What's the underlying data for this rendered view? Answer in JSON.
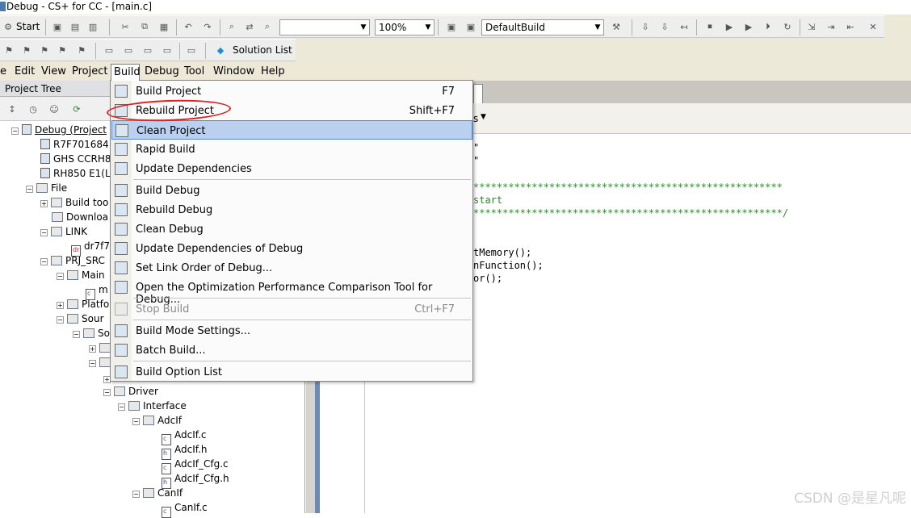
{
  "window": {
    "title": "Debug - CS+ for CC - [main.c]"
  },
  "toolbar": {
    "start_label": "Start",
    "zoom": "100%",
    "build_mode": "DefaultBuild",
    "solution_list_label": "Solution List"
  },
  "menubar": {
    "items": [
      "e",
      "Edit",
      "View",
      "Project",
      "Build",
      "Debug",
      "Tool",
      "Window",
      "Help"
    ]
  },
  "build_menu": {
    "items": [
      {
        "label": "Build Project",
        "shortcut": "F7"
      },
      {
        "label": "Rebuild Project",
        "shortcut": "Shift+F7"
      },
      {
        "label": "Clean Project",
        "shortcut": ""
      },
      {
        "label": "Rapid Build",
        "shortcut": ""
      },
      {
        "label": "Update Dependencies",
        "shortcut": ""
      },
      {
        "label": "Build Debug",
        "shortcut": ""
      },
      {
        "label": "Rebuild Debug",
        "shortcut": ""
      },
      {
        "label": "Clean Debug",
        "shortcut": ""
      },
      {
        "label": "Update Dependencies of Debug",
        "shortcut": ""
      },
      {
        "label": "Set Link Order of Debug...",
        "shortcut": ""
      },
      {
        "label": "Open the Optimization Performance Comparison Tool for Debug...",
        "shortcut": ""
      },
      {
        "label": "Stop Build",
        "shortcut": "Ctrl+F7"
      },
      {
        "label": "Build Mode Settings...",
        "shortcut": ""
      },
      {
        "label": "Batch Build...",
        "shortcut": ""
      },
      {
        "label": "Build Option List",
        "shortcut": ""
      }
    ],
    "highlighted": "Clean Project",
    "disabled": "Stop Build"
  },
  "project_tree": {
    "header": "Project Tree",
    "nodes": [
      "Debug (Project",
      "R7F701684",
      "GHS CCRH8",
      "RH850 E1(L",
      "File",
      "Build too",
      "Downloa",
      "LINK",
      "dr7f7",
      "PRJ_SRC",
      "Main",
      "m",
      "Platfo",
      "Sour",
      "So",
      "Driver",
      "Interface",
      "AdcIf",
      "AdcIf.c",
      "AdcIf.h",
      "AdcIf_Cfg.c",
      "AdcIf_Cfg.h",
      "CanIf",
      "CanIf.c"
    ]
  },
  "editor": {
    "toolbar_text": "s",
    "lines": [
      "\"",
      "\"",
      "*****************************************************",
      "start",
      "*****************************************************/",
      "tMemory();",
      "nFunction();",
      "or();"
    ]
  },
  "watermark": "CSDN @是星凡呢"
}
